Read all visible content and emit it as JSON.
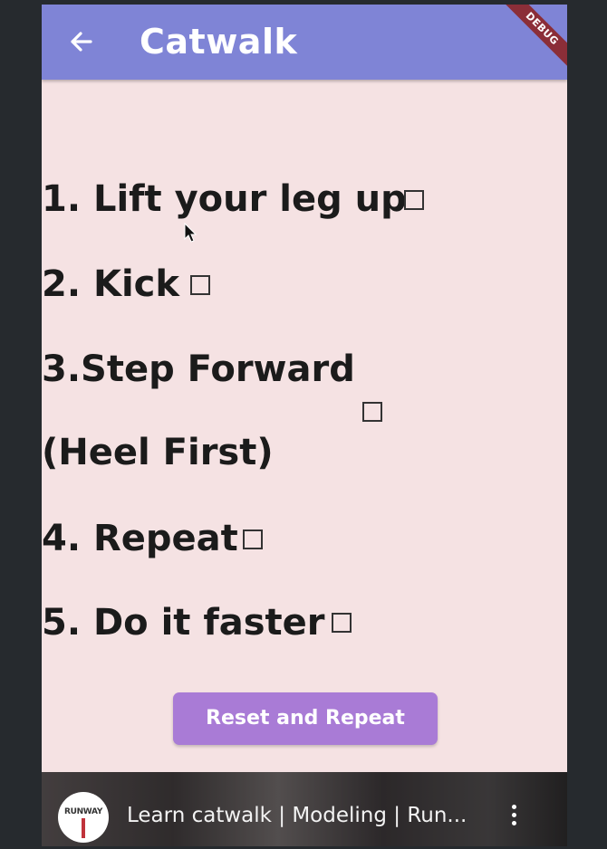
{
  "app_bar": {
    "title": "Catwalk",
    "back_icon": "arrow-back-icon",
    "debug_label": "DEBUG",
    "color": "#7f84d6"
  },
  "steps": [
    {
      "label": "1. Lift your leg up",
      "checked": false
    },
    {
      "label": "2. Kick",
      "checked": false
    },
    {
      "label": "3.Step Forward",
      "label_line2": "(Heel First)",
      "checked": false
    },
    {
      "label": "4. Repeat",
      "checked": false
    },
    {
      "label": "5. Do it faster",
      "checked": false
    }
  ],
  "reset_button": {
    "label": "Reset and Repeat",
    "color": "#a97bd6"
  },
  "video": {
    "channel_logo_text": "RUNWAY",
    "title": "Learn catwalk | Modeling | Run...",
    "more_icon": "more-vert-icon"
  },
  "colors": {
    "background": "#f5e2e3",
    "text": "#1b1b1b"
  }
}
